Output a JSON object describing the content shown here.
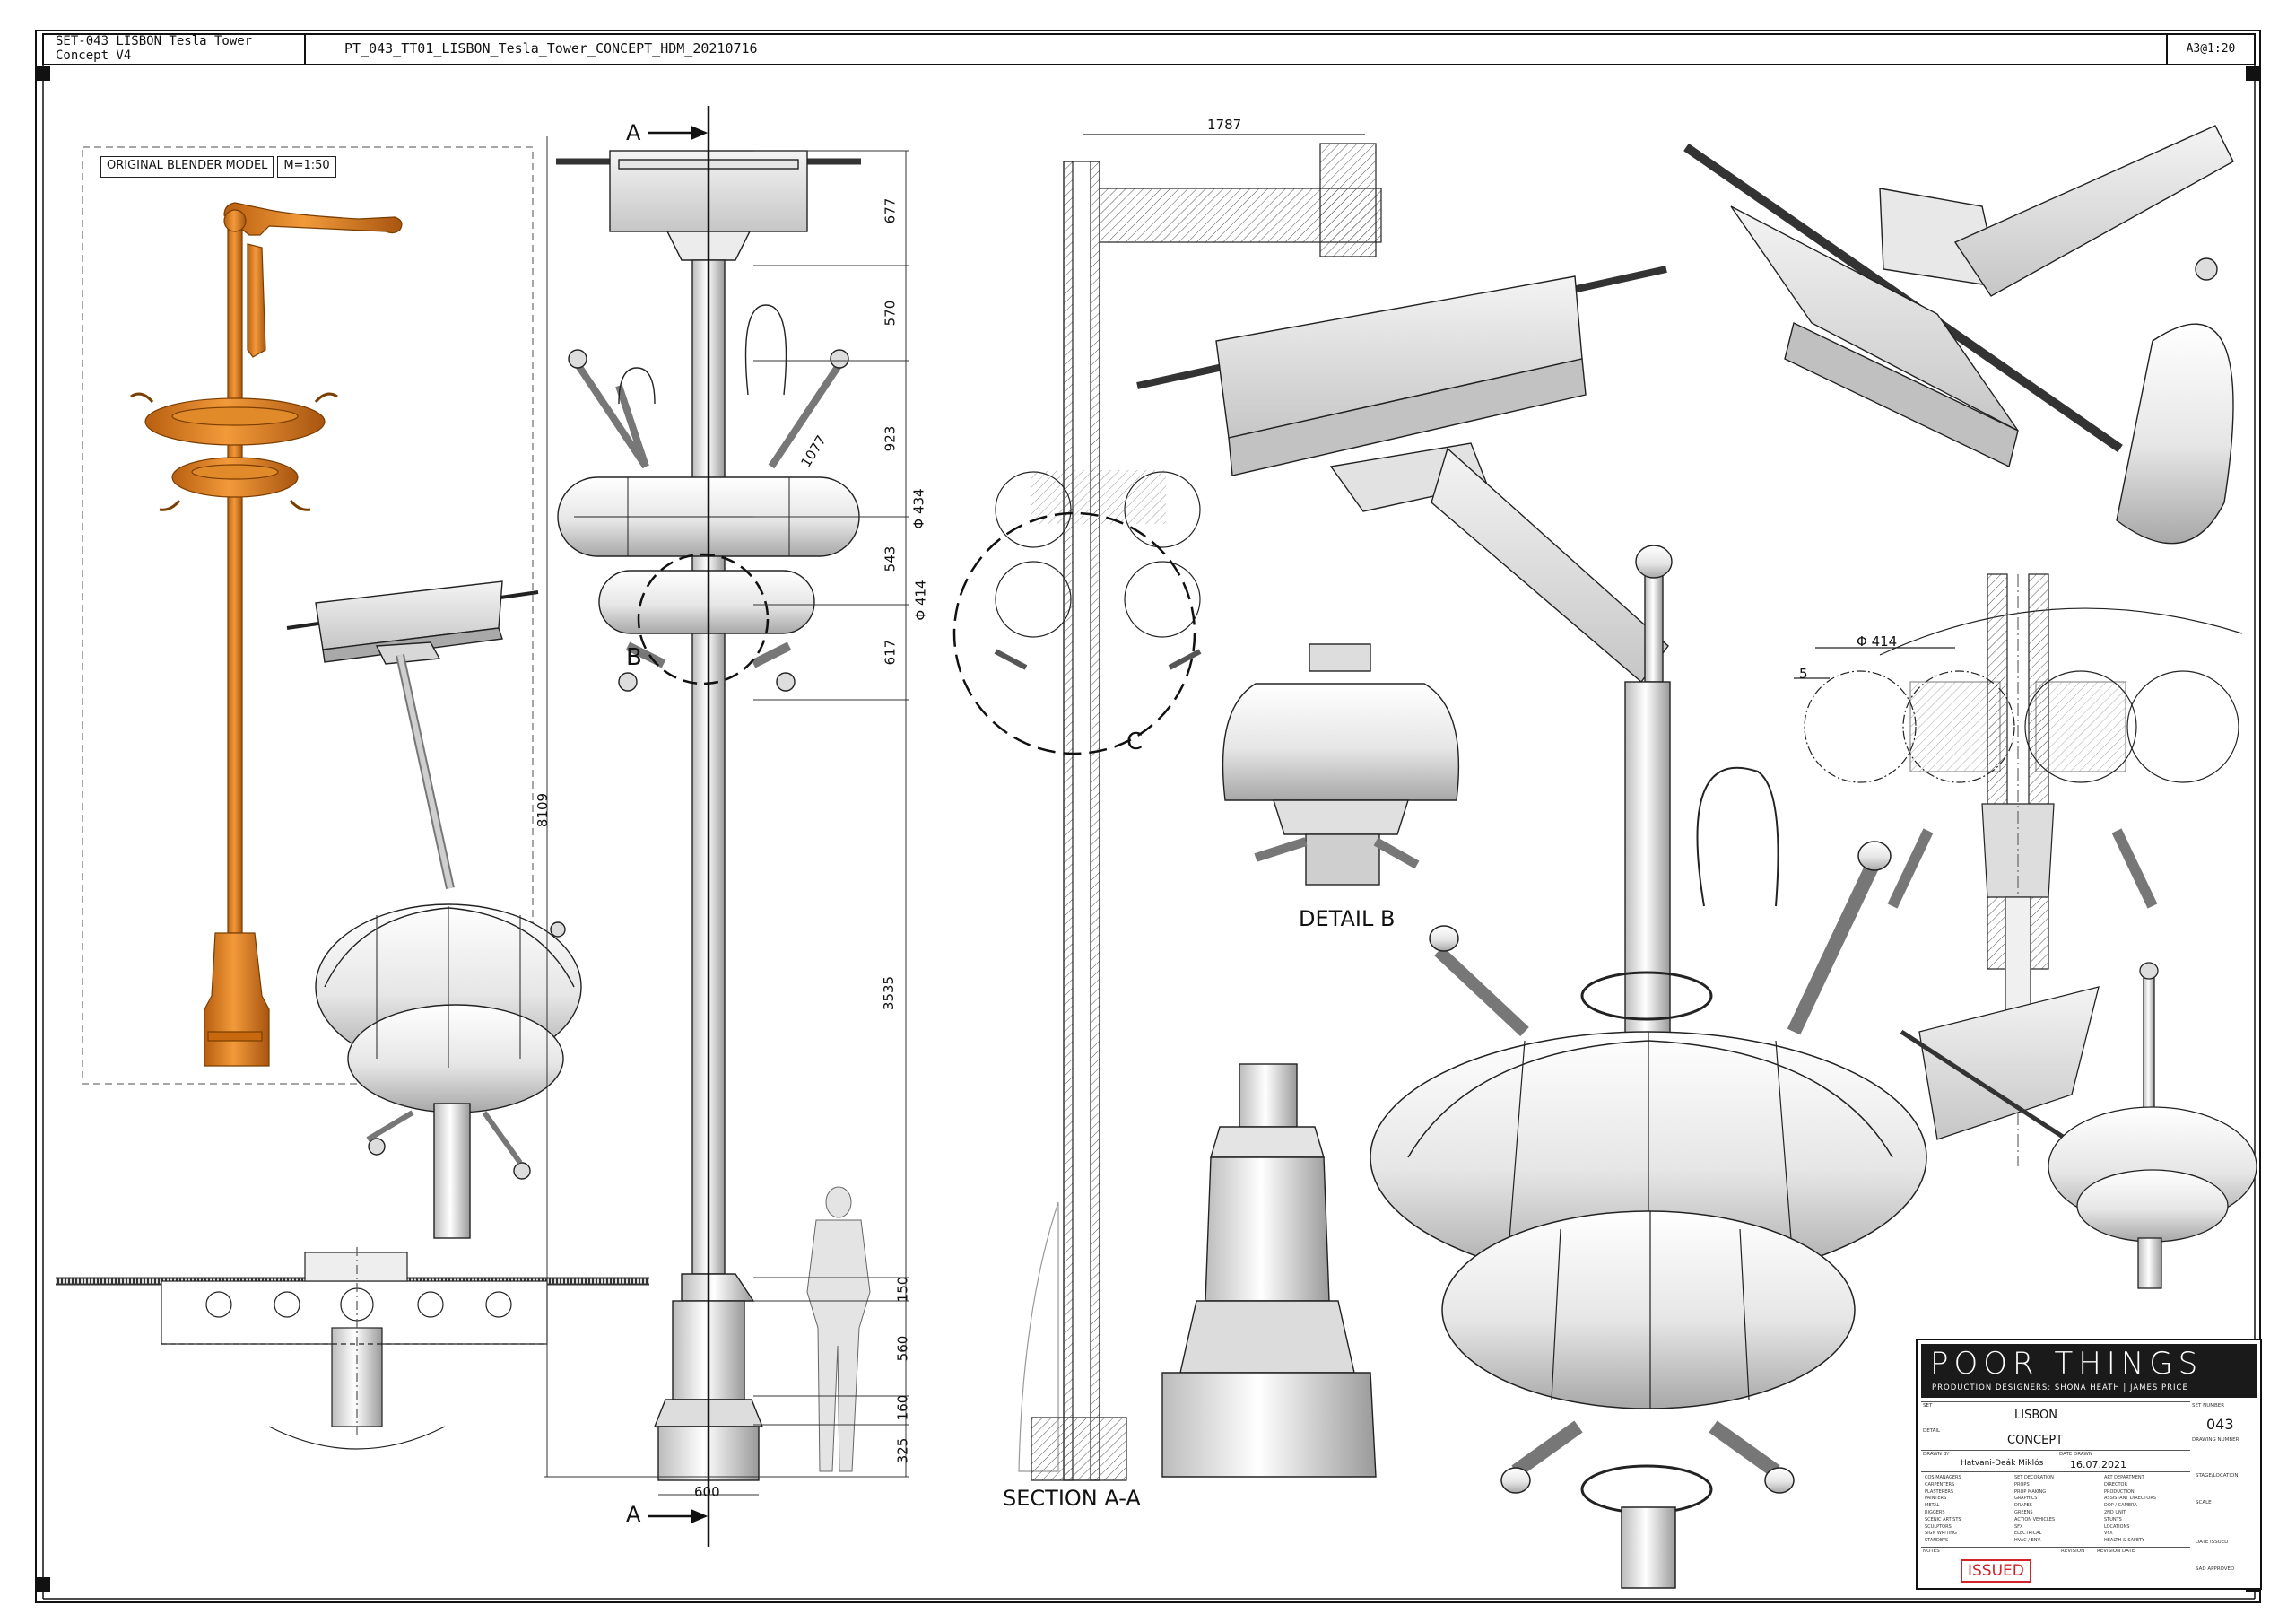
{
  "header": {
    "set_ref": "SET-043 LISBON Tesla Tower Concept V4",
    "file_name": "PT_043_TT01_LISBON_Tesla_Tower_CONCEPT_HDM_20210716",
    "sheet_scale": "A3@1:20"
  },
  "blender": {
    "label": "ORIGINAL BLENDER MODEL",
    "scale": "M=1:50"
  },
  "labels": {
    "cut_top": "A",
    "cut_bottom": "A",
    "detail_b_marker": "B",
    "detail_c_marker": "C",
    "section": "SECTION A-A",
    "detail_b": "DETAIL B"
  },
  "dimensions": {
    "d677": "677",
    "d570": "570",
    "d923": "923",
    "d543": "543",
    "d617": "617",
    "d3535": "3535",
    "d150": "150",
    "d560": "560",
    "d160": "160",
    "d325": "325",
    "d8109": "8109",
    "d1077": "1077",
    "d600": "600",
    "d1787": "1787",
    "phi434": "Φ 434",
    "phi414": "Φ 414",
    "detail_phi414": "Φ 414",
    "detail_5": "5"
  },
  "title_block": {
    "title": "POOR THINGS",
    "production_designers": "PRODUCTION DESIGNERS:  SHONA HEATH  |  JAMES PRICE",
    "set_label": "SET",
    "set_value": "LISBON",
    "set_number_label": "SET NUMBER",
    "set_number": "043",
    "detail_label": "DETAIL",
    "detail_value": "CONCEPT",
    "drawing_number_label": "DRAWING NUMBER",
    "drawn_by_label": "DRAWN BY",
    "drawn_by": "Hatvani-Deák Miklós",
    "date_drawn_label": "DATE DRAWN",
    "date_drawn": "16.07.2021",
    "stage_label": "STAGE/LOCATION",
    "scale_label": "SCALE",
    "date_issued_label": "DATE ISSUED",
    "sad_approved_label": "SAD APPROVED",
    "notes_label": "NOTES",
    "revision_label": "REVISION",
    "revision_date_label": "REVISION DATE",
    "status": "ISSUED",
    "departments": [
      [
        "COS MANAGERS",
        "SET DECORATION",
        "ART DEPARTMENT"
      ],
      [
        "CARPENTERS",
        "PROPS",
        "DIRECTOR"
      ],
      [
        "PLASTERERS",
        "PROP MAKING",
        "PRODUCTION"
      ],
      [
        "PAINTERS",
        "GRAPHICS",
        "ASSISTANT DIRECTORS"
      ],
      [
        "METAL",
        "DRAPES",
        "DOP / CAMERA"
      ],
      [
        "RIGGERS",
        "GREENS",
        "2ND UNIT"
      ],
      [
        "SCENIC ARTISTS",
        "ACTION VEHICLES",
        "STUNTS"
      ],
      [
        "SCULPTORS",
        "SFX",
        "LOCATIONS"
      ],
      [
        "SIGN WRITING",
        "ELECTRICAL",
        "VFX"
      ],
      [
        "STANDBYS",
        "HVAC / ENV.",
        "HEALTH & SAFETY"
      ]
    ]
  },
  "colors": {
    "model_orange": "#d9781f",
    "line": "#1a1a1a",
    "metal_light": "#f2f2f2",
    "metal_mid": "#bdbdbd",
    "issued_red": "#d2232a"
  }
}
